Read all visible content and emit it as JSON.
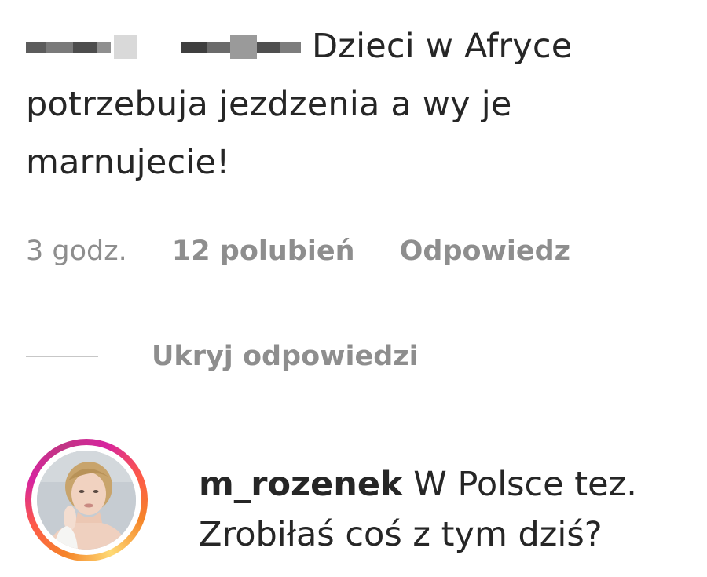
{
  "comment": {
    "text_line1": "Dzieci w Afryce",
    "text_rest": "potrzebuja jezdzenia a wy je marnujecie!",
    "time": "3 godz.",
    "likes": "12 polubień",
    "reply_label": "Odpowiedz"
  },
  "thread": {
    "hide_replies_label": "Ukryj odpowiedzi"
  },
  "reply": {
    "username": "m_rozenek",
    "text": "W Polsce tez. Zrobiłaś coś z tym dziś?"
  },
  "colors": {
    "text": "#262626",
    "meta": "#8e8e8e",
    "story_ring": [
      "#f58529",
      "#d6249f"
    ]
  },
  "icons": {
    "avatar": "profile-photo"
  }
}
